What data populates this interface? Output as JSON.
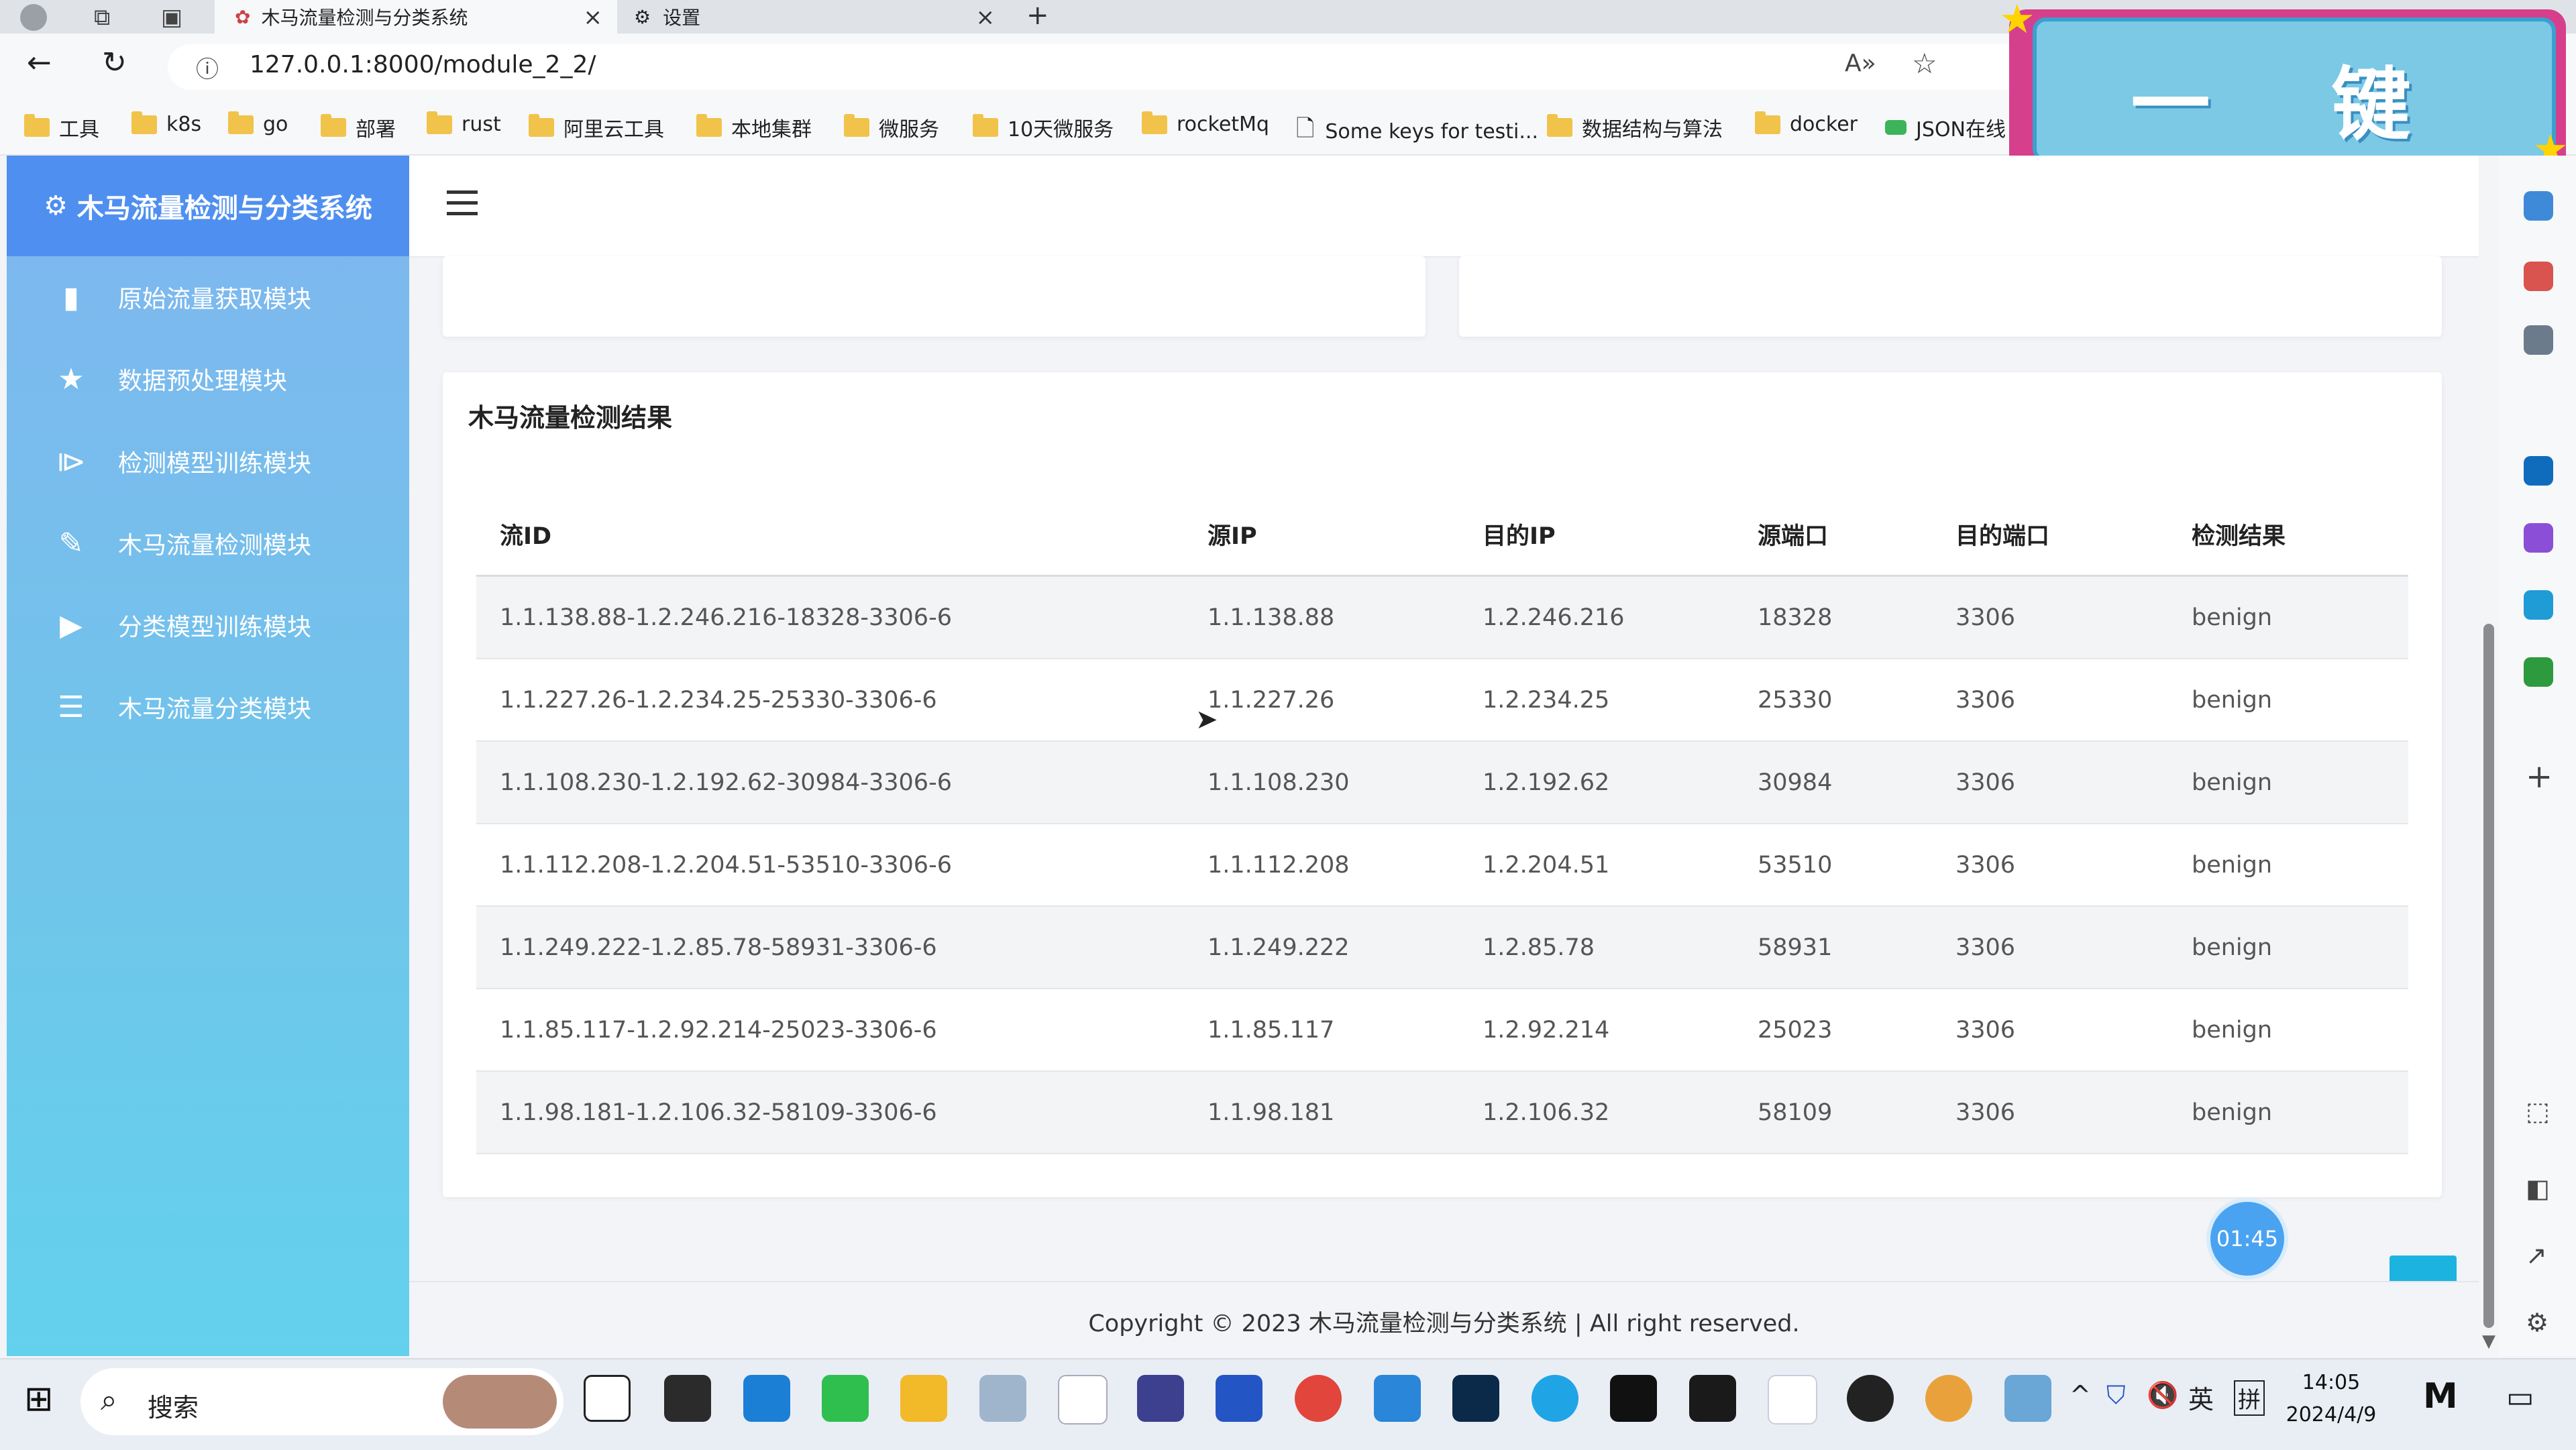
{
  "browser": {
    "tabs": [
      {
        "title": "木马流量检测与分类系统",
        "active": true
      },
      {
        "title": "设置",
        "active": false
      }
    ],
    "url": "127.0.0.1:8000/module_2_2/",
    "bookmarks": [
      "工具",
      "k8s",
      "go",
      "部署",
      "rust",
      "阿里云工具",
      "本地集群",
      "微服务",
      "10天微服务",
      "rocketMq",
      "Some keys for testi...",
      "数据结构与算法",
      "docker",
      "JSON在线"
    ]
  },
  "overlay": {
    "sticker_text": "一 键 三 连"
  },
  "sidebar": {
    "title": "木马流量检测与分类系统",
    "items": [
      {
        "label": "原始流量获取模块",
        "icon": "file-icon"
      },
      {
        "label": "数据预处理模块",
        "icon": "star-icon"
      },
      {
        "label": "检测模型训练模块",
        "icon": "play-box-icon"
      },
      {
        "label": "木马流量检测模块",
        "icon": "edit-icon"
      },
      {
        "label": "分类模型训练模块",
        "icon": "play-icon"
      },
      {
        "label": "木马流量分类模块",
        "icon": "tree-list-icon"
      }
    ]
  },
  "main": {
    "card_title": "木马流量检测结果",
    "table": {
      "headers": [
        "流ID",
        "源IP",
        "目的IP",
        "源端口",
        "目的端口",
        "检测结果"
      ],
      "rows": [
        [
          "1.1.138.88-1.2.246.216-18328-3306-6",
          "1.1.138.88",
          "1.2.246.216",
          "18328",
          "3306",
          "benign"
        ],
        [
          "1.1.227.26-1.2.234.25-25330-3306-6",
          "1.1.227.26",
          "1.2.234.25",
          "25330",
          "3306",
          "benign"
        ],
        [
          "1.1.108.230-1.2.192.62-30984-3306-6",
          "1.1.108.230",
          "1.2.192.62",
          "30984",
          "3306",
          "benign"
        ],
        [
          "1.1.112.208-1.2.204.51-53510-3306-6",
          "1.1.112.208",
          "1.2.204.51",
          "53510",
          "3306",
          "benign"
        ],
        [
          "1.1.249.222-1.2.85.78-58931-3306-6",
          "1.1.249.222",
          "1.2.85.78",
          "58931",
          "3306",
          "benign"
        ],
        [
          "1.1.85.117-1.2.92.214-25023-3306-6",
          "1.1.85.117",
          "1.2.92.214",
          "25023",
          "3306",
          "benign"
        ],
        [
          "1.1.98.181-1.2.106.32-58109-3306-6",
          "1.1.98.181",
          "1.2.106.32",
          "58109",
          "3306",
          "benign"
        ]
      ]
    },
    "footer": "Copyright © 2023 木马流量检测与分类系统 | All right reserved.",
    "timer": "01:45",
    "to_top_icon": "chevron-up-icon"
  },
  "taskbar": {
    "search_label": "搜索",
    "tray_lang": "英",
    "tray_ime": "拼",
    "time": "14:05",
    "date": "2024/4/9"
  },
  "colors": {
    "sidebar_header": "#4f8ff0",
    "accent": "#1db3e0",
    "sticker_border": "#d63f8c"
  }
}
